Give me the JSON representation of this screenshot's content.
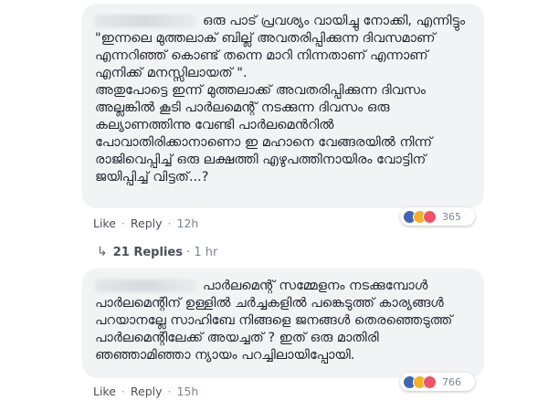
{
  "comments": [
    {
      "paragraphs": [
        "ഒരു പാട് പ്രവശ്യം വായിച്ചു നോക്കി, എന്നിട്ടും \"ഇന്നലെ മുത്തലാക് ബില്ല് അവതരിപ്പിക്കുന്ന ദിവസമാണ് എന്നറിഞ്ഞ് കൊണ്ട് തന്നെ മാറി നിന്നതാണ് എന്നാണ് എനിക്ക് മനസ്സിലായത് \".",
        "അതുപോട്ടെ ഇന്ന് മുത്തലാക്ക് അവതരിപ്പിക്കുന്ന ദിവസം അല്ലങ്കിൽ കൂടി പാർലമെന്റ് നടക്കുന്ന ദിവസം ഒരു കല്യാണത്തിന്നു വേണ്ടി പാർലമെൻറിൽ പോവാതിരിക്കാനാണൊ ഇ മഹാനെ വേങ്ങരയിൽ നിന്ന് രാജിവെപ്പിച്ച് ഒരു ലക്ഷത്തി എഴുപത്തിനായിരം വോട്ടിന് ജയിപ്പിച്ച് വിട്ടത്...?"
      ],
      "like_label": "Like",
      "reply_label": "Reply",
      "time": "12h",
      "reaction_count": "365"
    },
    {
      "paragraphs": [
        "പാർലമെന്റ് സമ്മേളനം നടക്കുമ്പോൾ പാർലമെന്റിന് ഉള്ളിൽ ചർച്ചകളിൽ പങ്കെടുത്ത് കാര്യങ്ങൾ പറയാനല്ലേ സാഹിബേ നിങ്ങളെ ജനങ്ങൾ തെരഞ്ഞെടുത്ത് പാർലമെന്റിലേക്ക് അയച്ചത് ? ഇത് ഒരു മാതിരി ഞഞ്ഞാമിഞ്ഞാ ന്യായം പറച്ചിലായിപ്പോയി."
      ],
      "like_label": "Like",
      "reply_label": "Reply",
      "time": "15h",
      "reaction_count": "766"
    }
  ],
  "replies": {
    "label": "21 Replies",
    "time": "1 hr",
    "arrow_icon": "reply-arrow-icon"
  },
  "reaction_icons": [
    "like-icon",
    "haha-icon",
    "love-icon"
  ],
  "colors": {
    "bubble": "#f2f3f5",
    "like": "#4267b2",
    "haha": "#f7b125",
    "love": "#f25268",
    "meta": "#7d8491"
  }
}
